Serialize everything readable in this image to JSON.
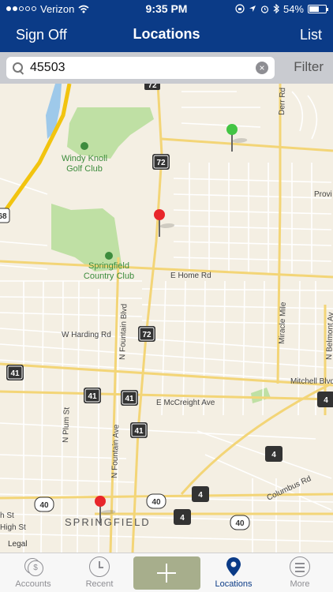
{
  "status": {
    "carrier": "Verizon",
    "time": "9:35 PM",
    "battery": "54%"
  },
  "nav": {
    "left": "Sign Off",
    "title": "Locations",
    "right": "List"
  },
  "search": {
    "value": "45503",
    "filter": "Filter"
  },
  "map": {
    "labels": {
      "windy_knoll": [
        "Windy Knoll",
        "Golf Club"
      ],
      "springfield_cc": [
        "Springfield",
        "Country Club"
      ],
      "e_home_rd": "E Home Rd",
      "w_harding_rd": "W Harding Rd",
      "n_fountain_blvd": "N Fountain Blvd",
      "mitchell_blvd": "Mitchell Blvd",
      "e_mccreight_ave": "E McCreight Ave",
      "n_plum_st": "N Plum St",
      "n_fountain_ave": "N Fountain Ave",
      "columbus_rd": "Columbus Rd",
      "miracle_mile": "Miracle Mile",
      "derr_rd": "Derr Rd",
      "n_belmont_ave": "N Belmont Av",
      "provi": "Provi",
      "h_st": "h St",
      "high_st": "High St",
      "springfield": "SPRINGFIELD",
      "legal": "Legal"
    },
    "shields": {
      "s72": "72",
      "s68": "68",
      "s41": "41",
      "s40": "40",
      "s4": "4"
    },
    "pin_colors": {
      "red": "#e8262b",
      "green": "#43c544"
    }
  },
  "tabs": [
    {
      "label": "Accounts"
    },
    {
      "label": "Recent"
    },
    {
      "label": "Locations"
    },
    {
      "label": "More"
    }
  ]
}
